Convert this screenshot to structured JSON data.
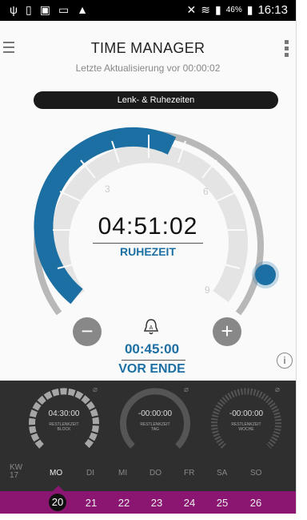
{
  "status_bar": {
    "icons_left": [
      "usb-icon",
      "phone-icon",
      "app-icon",
      "image-icon",
      "warning-icon"
    ],
    "battery_pct": "46%",
    "time": "16:13"
  },
  "header": {
    "title": "TIME MANAGER",
    "subtitle": "Letzte Aktualisierung vor 00:00:02"
  },
  "mode_pill": "Lenk- & Ruhezeiten",
  "dial": {
    "time": "04:51:02",
    "label": "RUHEZEIT",
    "tick_labels": [
      "3",
      "6",
      "9"
    ],
    "progress_fraction": 0.54,
    "accent": "#1c6fa3"
  },
  "countdown": {
    "value": "00:45:00",
    "label": "VOR ENDE"
  },
  "gauges": [
    {
      "value": "04:30:00",
      "label_line1": "RESTLENKZEIT",
      "label_line2": "BLOCK"
    },
    {
      "value": "-00:00:00",
      "label_line1": "RESTLENKZEIT",
      "label_line2": "TAG"
    },
    {
      "value": "-00:00:00",
      "label_line1": "RESTLENKZEIT",
      "label_line2": "WOCHE"
    }
  ],
  "week": {
    "kw_label": "KW",
    "kw_number": "17",
    "days": [
      "MO",
      "DI",
      "MI",
      "DO",
      "FR",
      "SA",
      "SO"
    ],
    "dates": [
      "20",
      "21",
      "22",
      "23",
      "24",
      "25",
      "26"
    ],
    "selected_index": 0
  },
  "colors": {
    "accent_blue": "#1c6fa3",
    "date_bar": "#8a1672",
    "dark_panel": "#2f2f2f"
  }
}
